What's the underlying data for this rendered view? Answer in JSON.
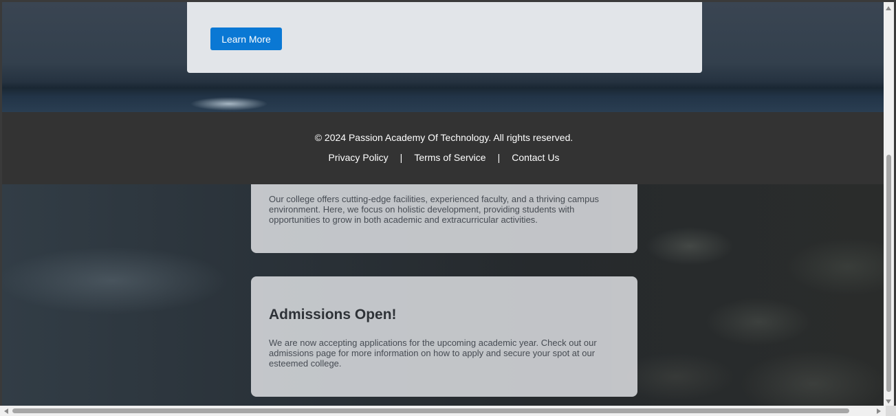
{
  "hero": {
    "learn_more_label": "Learn More"
  },
  "footer": {
    "copyright": "© 2024 Passion Academy Of Technology. All rights reserved.",
    "links": [
      {
        "label": "Privacy Policy"
      },
      {
        "label": "Terms of Service"
      },
      {
        "label": "Contact Us"
      }
    ],
    "separator": "|"
  },
  "about": {
    "text": "Our college offers cutting-edge facilities, experienced faculty, and a thriving campus environment. Here, we focus on holistic development, providing students with opportunities to grow in both academic and extracurricular activities."
  },
  "admissions": {
    "title": "Admissions Open!",
    "text": "We are now accepting applications for the upcoming academic year. Check out our admissions page for more information on how to apply and secure your spot at our esteemed college."
  },
  "colors": {
    "accent": "#0a78d4",
    "footer_background": "#333333"
  }
}
